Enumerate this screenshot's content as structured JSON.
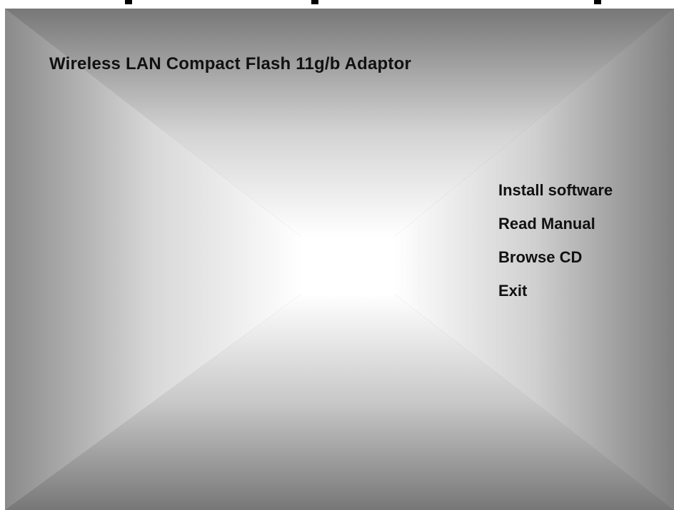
{
  "window": {
    "title": "Wireless LAN Compact Flash 11g/b Adaptor"
  },
  "menu": {
    "items": [
      {
        "label": "Install software"
      },
      {
        "label": "Read Manual"
      },
      {
        "label": "Browse CD"
      },
      {
        "label": "Exit"
      }
    ]
  },
  "colors": {
    "edge_gray": "#7a7a7a",
    "center_white": "#ffffff",
    "text": "#111111"
  }
}
